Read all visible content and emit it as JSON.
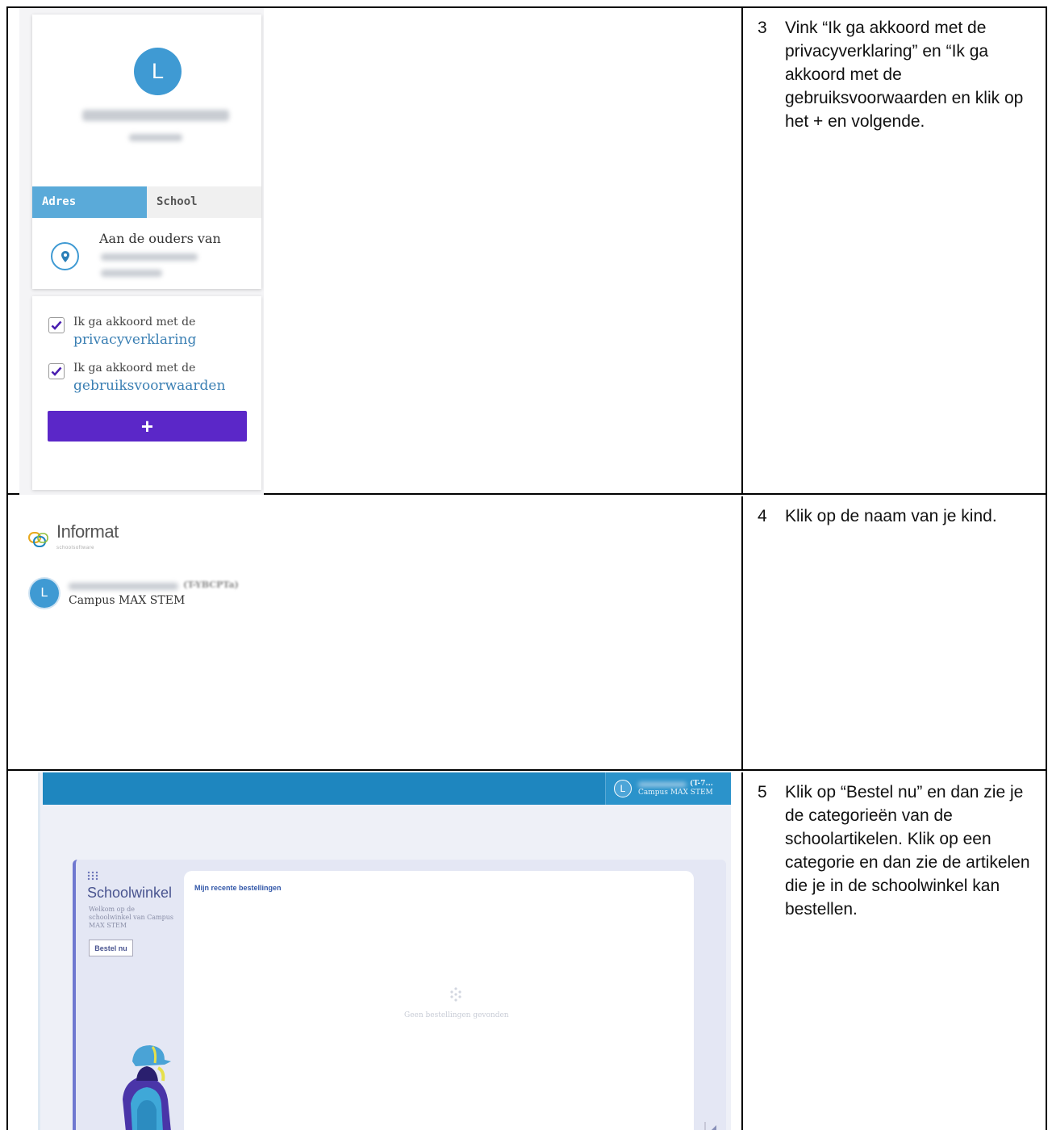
{
  "rows": [
    {
      "number": "3",
      "instruction": "Vink “Ik ga akkoord met de privacyverklaring” en “Ik ga akkoord met de gebruiksvoorwaarden en klik op het + en volgende."
    },
    {
      "number": "4",
      "instruction": "Klik op de naam van je kind."
    },
    {
      "number": "5",
      "instruction": "Klik op “Bestel nu” en dan zie je de categorieën van de schoolartikelen. Klik op een categorie en dan zie de artikelen die je in de schoolwinkel kan bestellen."
    }
  ],
  "profile_card": {
    "avatar_letter": "L",
    "tabs": [
      "Adres",
      "School"
    ],
    "address_label": "Aan de ouders van",
    "consents": [
      {
        "prefix": "Ik ga akkoord met de",
        "link": "privacyverklaring",
        "checked": true
      },
      {
        "prefix": "Ik ga akkoord met de",
        "link": "gebruiksvoorwaarden",
        "checked": true
      }
    ],
    "add_button": "+"
  },
  "informat": {
    "logo_text": "Informat",
    "logo_sub": "schoolsoftware",
    "child_avatar_letter": "L",
    "child_code": "(T-YBCPTa)",
    "child_school": "Campus MAX STEM"
  },
  "schoolwinkel": {
    "user_avatar_letter": "L",
    "user_code": "(T-7...",
    "user_school": "Campus MAX STEM",
    "title": "Schoolwinkel",
    "welcome": "Welkom op de schoolwinkel van Campus MAX STEM",
    "order_button": "Bestel nu",
    "recent_orders_title": "Mijn recente bestellingen",
    "empty_message": "Geen bestellingen gevonden"
  },
  "colors": {
    "accent_blue": "#3f9ad3",
    "topbar_blue": "#1e86bf",
    "primary_purple": "#5b27c8",
    "link_blue": "#3a7fb3"
  }
}
